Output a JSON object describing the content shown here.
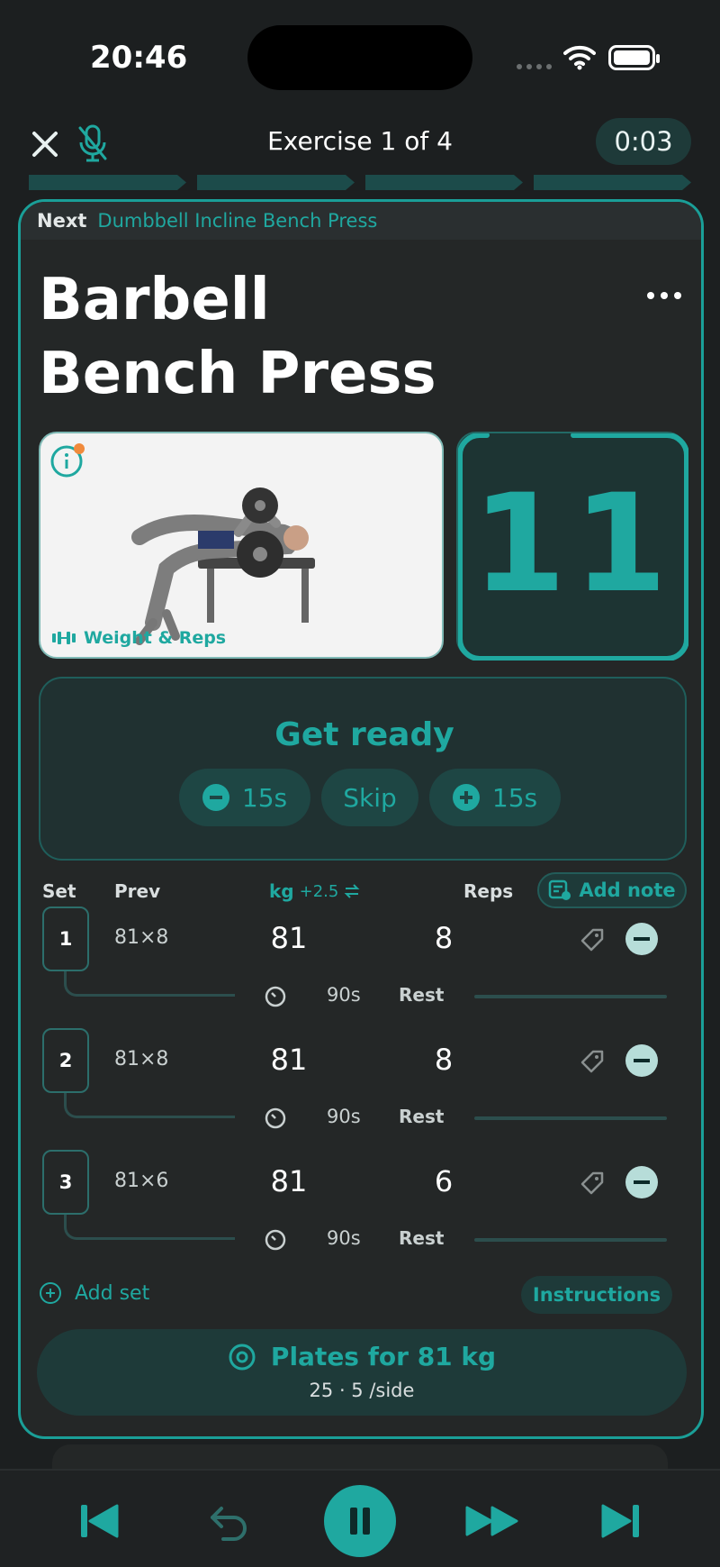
{
  "status": {
    "time": "20:46"
  },
  "header": {
    "exercise_counter": "Exercise 1 of 4",
    "elapsed": "0:03"
  },
  "card": {
    "next_label": "Next",
    "next_exercise": "Dumbbell Incline Bench Press",
    "title_line1": "Barbell",
    "title_line2": "Bench Press",
    "tracking_type": "Weight & Reps",
    "countdown": "11",
    "countdown_progress": 0.1,
    "ready": {
      "title": "Get ready",
      "minus_label": "15s",
      "skip_label": "Skip",
      "plus_label": "15s"
    },
    "table": {
      "headers": {
        "set": "Set",
        "prev": "Prev",
        "kg": "kg",
        "kg_increment": "+2.5",
        "reps": "Reps"
      },
      "add_note": "Add note",
      "rest_label": "Rest",
      "rows": [
        {
          "set": "1",
          "prev": "81×8",
          "kg": "81",
          "reps": "8",
          "rest": "90s"
        },
        {
          "set": "2",
          "prev": "81×8",
          "kg": "81",
          "reps": "8",
          "rest": "90s"
        },
        {
          "set": "3",
          "prev": "81×6",
          "kg": "81",
          "reps": "6",
          "rest": "90s"
        }
      ]
    },
    "add_set": "Add set",
    "instructions": "Instructions",
    "plates": {
      "title": "Plates for 81 kg",
      "detail": "25 · 5 /side"
    }
  },
  "colors": {
    "accent": "#1fa8a0",
    "background": "#1c1f20",
    "card": "#242727"
  },
  "icons": {
    "close": "close-icon",
    "mic": "mic-off-icon",
    "info": "info-icon",
    "dumbbell": "dumbbell-icon",
    "note": "note-icon",
    "tag": "tag-icon",
    "timer": "timer-icon",
    "plates": "target-icon",
    "prev": "skip-start-icon",
    "undo": "undo-icon",
    "pause": "pause-icon",
    "ff": "fast-forward-icon",
    "next": "skip-end-icon"
  }
}
